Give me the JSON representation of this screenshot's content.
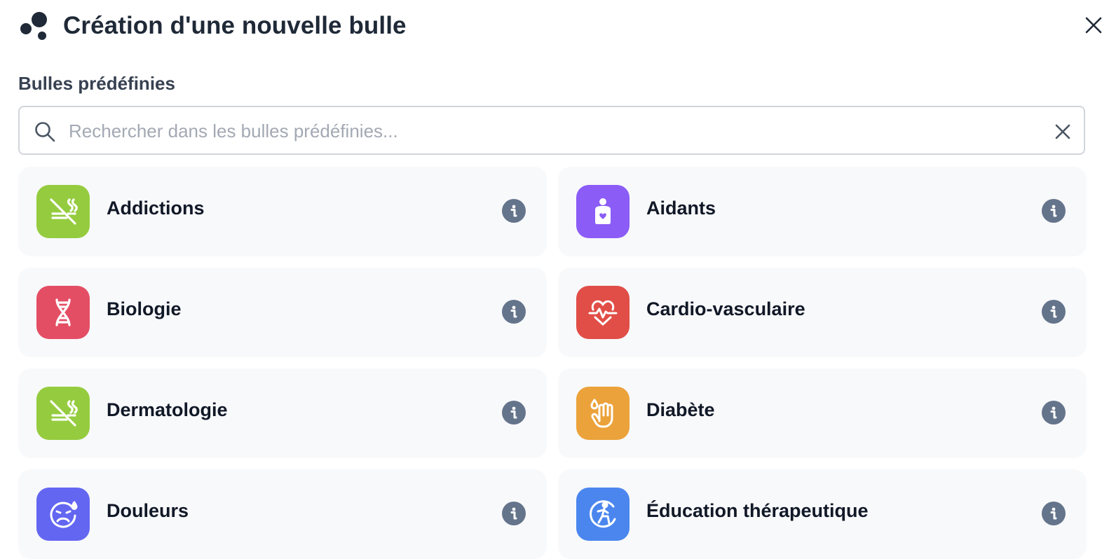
{
  "modal": {
    "title": "Création d'une nouvelle bulle",
    "brand_icon": "bubbles-logo-icon",
    "close_icon": "close-icon"
  },
  "section": {
    "label": "Bulles prédéfinies"
  },
  "search": {
    "placeholder": "Rechercher dans les bulles prédéfinies...",
    "value": "",
    "icon": "search-icon",
    "clear_icon": "clear-icon"
  },
  "bubbles": [
    {
      "label": "Addictions",
      "icon": "no-smoking-icon",
      "color": "#95cc3f"
    },
    {
      "label": "Aidants",
      "icon": "caregiver-icon",
      "color": "#8b5cf6"
    },
    {
      "label": "Biologie",
      "icon": "dna-icon",
      "color": "#e44e64"
    },
    {
      "label": "Cardio-vasculaire",
      "icon": "heart-pulse-icon",
      "color": "#e14e47"
    },
    {
      "label": "Dermatologie",
      "icon": "no-smoking-icon",
      "color": "#95cc3f"
    },
    {
      "label": "Diabète",
      "icon": "finger-prick-icon",
      "color": "#eba23a"
    },
    {
      "label": "Douleurs",
      "icon": "pain-face-icon",
      "color": "#6366f1"
    },
    {
      "label": "Éducation thérapeutique",
      "icon": "accessibility-icon",
      "color": "#4a86ee"
    }
  ],
  "colors": {
    "text": "#1f2937",
    "card_bg": "#f8f9fb",
    "info_bg": "#64748b",
    "border": "#d1d5db"
  }
}
